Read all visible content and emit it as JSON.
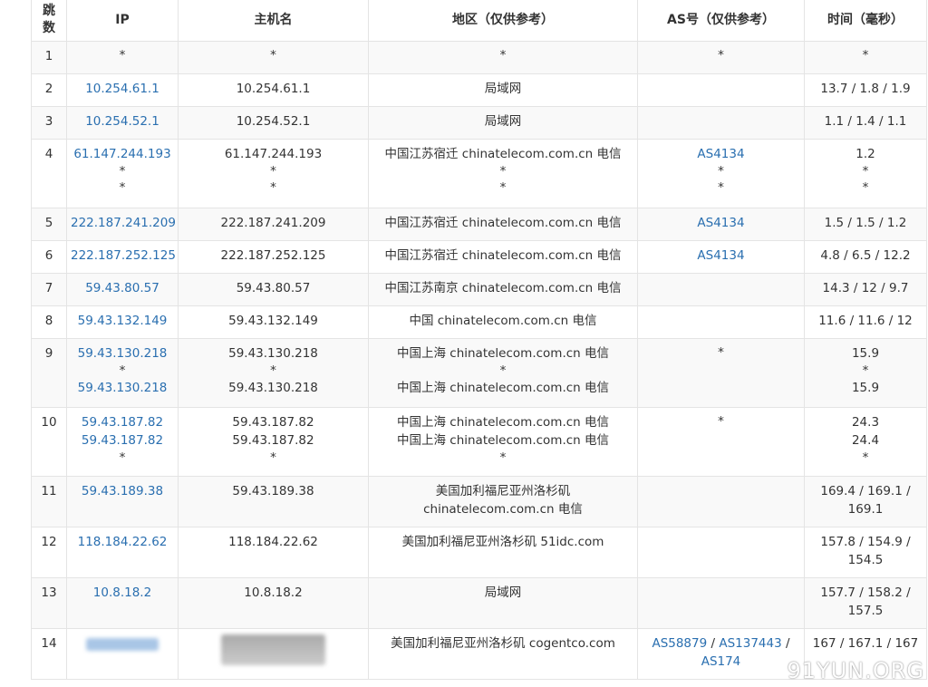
{
  "headers": {
    "hop": "跳数",
    "ip": "IP",
    "host": "主机名",
    "region": "地区（仅供参考）",
    "as": "AS号（仅供参考）",
    "time": "时间（毫秒）"
  },
  "rows": [
    {
      "hop": "1",
      "ip": [
        "*"
      ],
      "host": [
        "*"
      ],
      "region": [
        "*"
      ],
      "as": [
        "*"
      ],
      "time": [
        "*"
      ]
    },
    {
      "hop": "2",
      "ip": [
        "10.254.61.1"
      ],
      "host": [
        "10.254.61.1"
      ],
      "region": [
        "局域网"
      ],
      "as": [],
      "time": [
        "13.7 / 1.8 / 1.9"
      ]
    },
    {
      "hop": "3",
      "ip": [
        "10.254.52.1"
      ],
      "host": [
        "10.254.52.1"
      ],
      "region": [
        "局域网"
      ],
      "as": [],
      "time": [
        "1.1 / 1.4 / 1.1"
      ]
    },
    {
      "hop": "4",
      "ip": [
        "61.147.244.193",
        "*",
        "*"
      ],
      "host": [
        "61.147.244.193",
        "*",
        "*"
      ],
      "region": [
        "中国江苏宿迁 chinatelecom.com.cn 电信",
        "*",
        "*"
      ],
      "as": [
        "AS4134",
        "*",
        "*"
      ],
      "time": [
        "1.2",
        "*",
        "*"
      ]
    },
    {
      "hop": "5",
      "ip": [
        "222.187.241.209"
      ],
      "host": [
        "222.187.241.209"
      ],
      "region": [
        "中国江苏宿迁 chinatelecom.com.cn 电信"
      ],
      "as": [
        "AS4134"
      ],
      "time": [
        "1.5 / 1.5 / 1.2"
      ]
    },
    {
      "hop": "6",
      "ip": [
        "222.187.252.125"
      ],
      "host": [
        "222.187.252.125"
      ],
      "region": [
        "中国江苏宿迁 chinatelecom.com.cn 电信"
      ],
      "as": [
        "AS4134"
      ],
      "time": [
        "4.8 / 6.5 / 12.2"
      ]
    },
    {
      "hop": "7",
      "ip": [
        "59.43.80.57"
      ],
      "host": [
        "59.43.80.57"
      ],
      "region": [
        "中国江苏南京 chinatelecom.com.cn 电信"
      ],
      "as": [],
      "time": [
        "14.3 / 12 / 9.7"
      ]
    },
    {
      "hop": "8",
      "ip": [
        "59.43.132.149"
      ],
      "host": [
        "59.43.132.149"
      ],
      "region": [
        "中国 chinatelecom.com.cn 电信"
      ],
      "as": [],
      "time": [
        "11.6 / 11.6 / 12"
      ]
    },
    {
      "hop": "9",
      "ip": [
        "59.43.130.218",
        "*",
        "59.43.130.218"
      ],
      "host": [
        "59.43.130.218",
        "*",
        "59.43.130.218"
      ],
      "region": [
        "中国上海 chinatelecom.com.cn 电信",
        "*",
        "中国上海 chinatelecom.com.cn 电信"
      ],
      "as": [
        "",
        "*",
        ""
      ],
      "time": [
        "15.9",
        "*",
        "15.9"
      ]
    },
    {
      "hop": "10",
      "ip": [
        "59.43.187.82",
        "59.43.187.82",
        "*"
      ],
      "host": [
        "59.43.187.82",
        "59.43.187.82",
        "*"
      ],
      "region": [
        "中国上海 chinatelecom.com.cn 电信",
        "中国上海 chinatelecom.com.cn 电信",
        "*"
      ],
      "as": [
        "",
        "",
        "*"
      ],
      "time": [
        "24.3",
        "24.4",
        "*"
      ]
    },
    {
      "hop": "11",
      "ip": [
        "59.43.189.38"
      ],
      "host": [
        "59.43.189.38"
      ],
      "region": [
        "美国加利福尼亚州洛杉矶",
        "chinatelecom.com.cn 电信"
      ],
      "as": [],
      "time": [
        "169.4 / 169.1 /",
        "169.1"
      ]
    },
    {
      "hop": "12",
      "ip": [
        "118.184.22.62"
      ],
      "host": [
        "118.184.22.62"
      ],
      "region": [
        "美国加利福尼亚州洛杉矶 51idc.com"
      ],
      "as": [],
      "time": [
        "157.8 / 154.9 /",
        "154.5"
      ]
    },
    {
      "hop": "13",
      "ip": [
        "10.8.18.2"
      ],
      "host": [
        "10.8.18.2"
      ],
      "region": [
        "局域网"
      ],
      "as": [],
      "time": [
        "157.7 / 158.2 /",
        "157.5"
      ]
    },
    {
      "hop": "14",
      "ip": [
        "blurred"
      ],
      "host": [
        "blurred"
      ],
      "region": [
        "美国加利福尼亚州洛杉矶 cogentco.com"
      ],
      "as": [
        "AS58879 / AS137443 /",
        "AS174"
      ],
      "time": [
        "167 / 167.1 / 167"
      ]
    }
  ],
  "watermark": "91YUN.ORG"
}
